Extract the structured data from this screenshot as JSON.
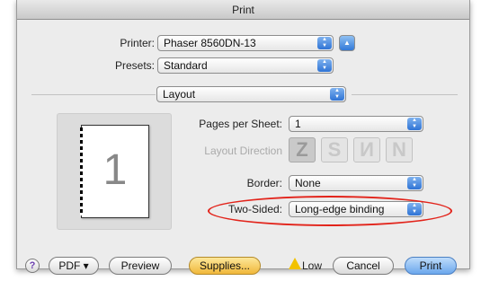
{
  "window": {
    "title": "Print"
  },
  "printer": {
    "label": "Printer:",
    "value": "Phaser 8560DN-13"
  },
  "presets": {
    "label": "Presets:",
    "value": "Standard"
  },
  "section": {
    "value": "Layout"
  },
  "layout": {
    "pages_per_sheet_label": "Pages per Sheet:",
    "pages_per_sheet_value": "1",
    "direction_label": "Layout Direction",
    "direction_options": [
      "Z",
      "S",
      "И",
      "N"
    ],
    "border_label": "Border:",
    "border_value": "None",
    "two_sided_label": "Two-Sided:",
    "two_sided_value": "Long-edge binding"
  },
  "preview": {
    "page_number": "1"
  },
  "footer": {
    "help": "?",
    "pdf": "PDF ▾",
    "preview": "Preview",
    "supplies": "Supplies...",
    "supply_status": "Low",
    "cancel": "Cancel",
    "print": "Print"
  },
  "icons": {
    "popup_arrows": "up-down-arrows-icon",
    "disclosure": "triangle-up-icon",
    "warning": "warning-triangle-icon"
  },
  "colors": {
    "highlight": "#e2231a",
    "accent": "#3179d8"
  }
}
